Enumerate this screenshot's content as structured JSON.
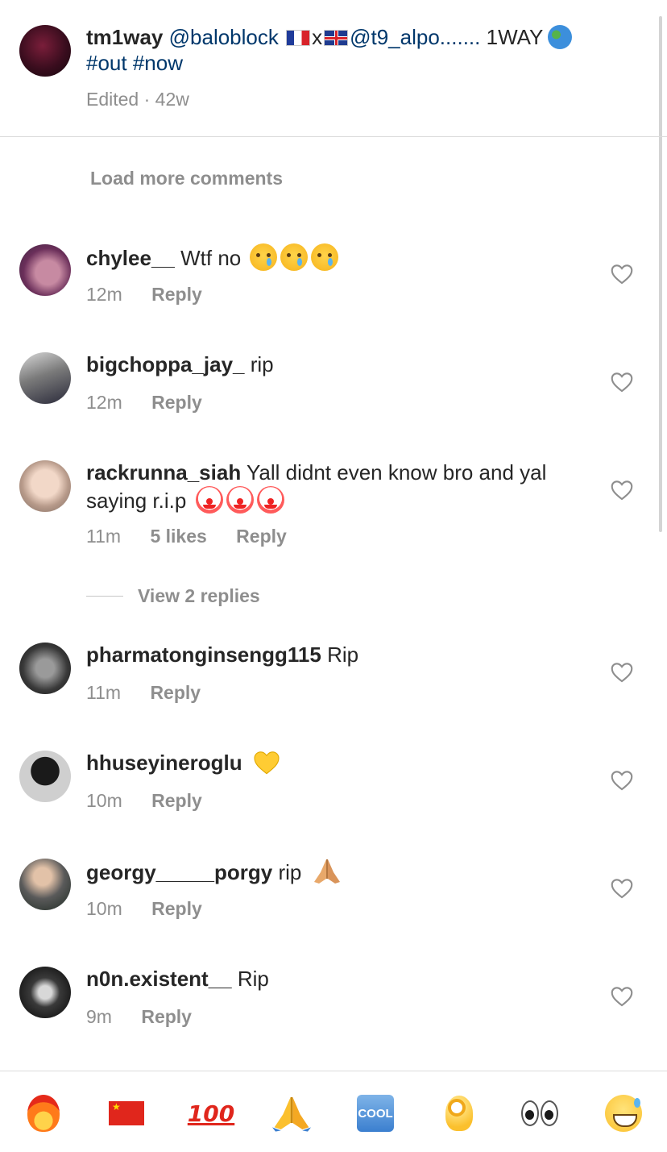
{
  "caption": {
    "username": "tm1way",
    "mention1": "@baloblock",
    "cross": "x",
    "mention2": "@t9_alpo.......",
    "tail": "1WAY",
    "tag1": "#out",
    "tag2": "#now",
    "meta": "Edited · 42w",
    "avatar_icon": "profile-avatar"
  },
  "load_more": "Load more comments",
  "comments": [
    {
      "username": "chylee__",
      "text": "Wtf no",
      "emoji": "crying-face-icon",
      "time": "12m",
      "likes": "",
      "reply": "Reply"
    },
    {
      "username": "bigchoppa_jay_",
      "text": "rip",
      "time": "12m",
      "likes": "",
      "reply": "Reply"
    },
    {
      "username": "rackrunna_siah",
      "text": "Yall didnt even know bro and yal saying r.i.p",
      "emoji": "clown-face-icon",
      "time": "11m",
      "likes": "5 likes",
      "reply": "Reply"
    },
    {
      "username": "pharmatonginsengg115",
      "text": "Rip",
      "time": "11m",
      "likes": "",
      "reply": "Reply"
    },
    {
      "username": "hhuseyineroglu",
      "text": "",
      "emoji": "yellow-heart-icon",
      "time": "10m",
      "likes": "",
      "reply": "Reply"
    },
    {
      "username": "georgy_____porgy",
      "text": "rip",
      "emoji": "folded-hands-icon",
      "time": "10m",
      "likes": "",
      "reply": "Reply"
    },
    {
      "username": "n0n.existent__",
      "text": "Rip",
      "time": "9m",
      "likes": "",
      "reply": "Reply"
    }
  ],
  "view_replies": "View 2 replies",
  "emoji_bar": [
    "fire",
    "china-flag",
    "hundred-points",
    "folded-hands",
    "cool",
    "ok-hand",
    "eyes",
    "grinning-sweat"
  ],
  "emoji_bar_text": {
    "hundred": "100",
    "cool": "COOL"
  },
  "colors": {
    "text": "#262626",
    "muted": "#8e8e8e",
    "link": "#00376b",
    "divider": "#dbdbdb"
  }
}
